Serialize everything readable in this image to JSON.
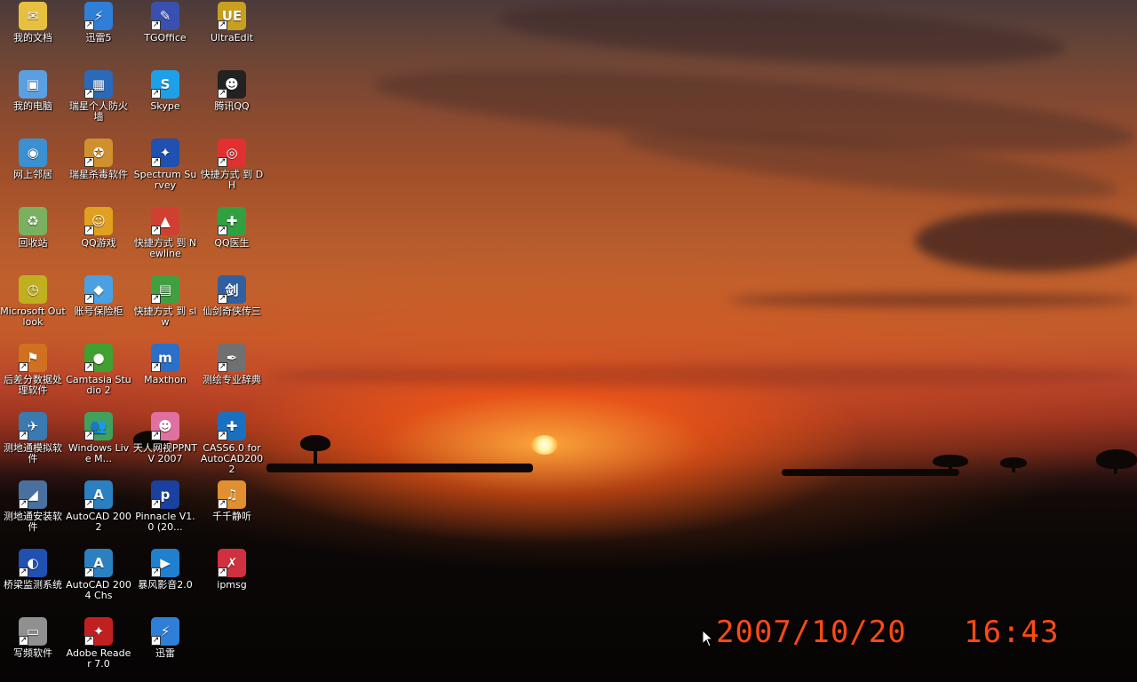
{
  "desktop": {
    "icons": [
      {
        "label": "我的文档",
        "color": "#e8c040",
        "glyph": "✉",
        "shortcut": false
      },
      {
        "label": "迅雷5",
        "color": "#2f7fd8",
        "glyph": "⚡",
        "shortcut": true
      },
      {
        "label": "TGOffice",
        "color": "#3a50b0",
        "glyph": "✎",
        "shortcut": true
      },
      {
        "label": "UltraEdit",
        "color": "#c8a020",
        "glyph": "UE",
        "shortcut": true
      },
      {
        "label": "我的电脑",
        "color": "#5aa0e0",
        "glyph": "▣",
        "shortcut": false
      },
      {
        "label": "瑞星个人防火墙",
        "color": "#2a6ab8",
        "glyph": "▦",
        "shortcut": true
      },
      {
        "label": "Skype",
        "color": "#1ea0e8",
        "glyph": "S",
        "shortcut": true
      },
      {
        "label": "腾讯QQ",
        "color": "#222222",
        "glyph": "☻",
        "shortcut": true
      },
      {
        "label": "网上邻居",
        "color": "#3a90d0",
        "glyph": "◉",
        "shortcut": false
      },
      {
        "label": "瑞星杀毒软件",
        "color": "#d09030",
        "glyph": "✪",
        "shortcut": true
      },
      {
        "label": "Spectrum Survey",
        "color": "#2050b0",
        "glyph": "✦",
        "shortcut": true
      },
      {
        "label": "快捷方式 到 DH",
        "color": "#e03030",
        "glyph": "◎",
        "shortcut": true
      },
      {
        "label": "回收站",
        "color": "#7ab060",
        "glyph": "♻",
        "shortcut": false
      },
      {
        "label": "QQ游戏",
        "color": "#e0a020",
        "glyph": "☺",
        "shortcut": true
      },
      {
        "label": "快捷方式 到 Newline",
        "color": "#d04030",
        "glyph": "▲",
        "shortcut": true
      },
      {
        "label": "QQ医生",
        "color": "#30a040",
        "glyph": "✚",
        "shortcut": true
      },
      {
        "label": "Microsoft Outlook",
        "color": "#c0b020",
        "glyph": "◷",
        "shortcut": false
      },
      {
        "label": "账号保险柜",
        "color": "#4aa0e0",
        "glyph": "◆",
        "shortcut": true
      },
      {
        "label": "快捷方式 到 slw",
        "color": "#40a040",
        "glyph": "▤",
        "shortcut": true
      },
      {
        "label": "仙剑奇侠传三",
        "color": "#3060a0",
        "glyph": "剑",
        "shortcut": true
      },
      {
        "label": "后差分数据处理软件",
        "color": "#d07020",
        "glyph": "⚑",
        "shortcut": true
      },
      {
        "label": "Camtasia Studio 2",
        "color": "#40a030",
        "glyph": "●",
        "shortcut": true
      },
      {
        "label": "Maxthon",
        "color": "#2a70c8",
        "glyph": "m",
        "shortcut": true
      },
      {
        "label": "测绘专业辞典",
        "color": "#707070",
        "glyph": "✒",
        "shortcut": true
      },
      {
        "label": "测地通模拟软件",
        "color": "#3a7ab0",
        "glyph": "✈",
        "shortcut": true
      },
      {
        "label": "Windows Live M...",
        "color": "#40a060",
        "glyph": "👥",
        "shortcut": true
      },
      {
        "label": "天人网视PPNTV 2007",
        "color": "#e070a0",
        "glyph": "☻",
        "shortcut": true
      },
      {
        "label": "CASS6.0 for AutoCAD2002",
        "color": "#1a70c0",
        "glyph": "✚",
        "shortcut": true
      },
      {
        "label": "测地通安装软件",
        "color": "#4a70a0",
        "glyph": "◢",
        "shortcut": true
      },
      {
        "label": "AutoCAD 2002",
        "color": "#2a80c0",
        "glyph": "A",
        "shortcut": true
      },
      {
        "label": "Pinnacle V1.0 (20...",
        "color": "#1a40a0",
        "glyph": "p",
        "shortcut": true
      },
      {
        "label": "千千静听",
        "color": "#e09030",
        "glyph": "♫",
        "shortcut": true
      },
      {
        "label": "桥梁监测系统",
        "color": "#2050b0",
        "glyph": "◐",
        "shortcut": true
      },
      {
        "label": "AutoCAD 2004 Chs",
        "color": "#2a80c0",
        "glyph": "A",
        "shortcut": true
      },
      {
        "label": "暴风影音2.0",
        "color": "#2080d0",
        "glyph": "▶",
        "shortcut": true
      },
      {
        "label": "ipmsg",
        "color": "#d03040",
        "glyph": "✗",
        "shortcut": true
      },
      {
        "label": "写频软件",
        "color": "#909090",
        "glyph": "▭",
        "shortcut": true
      },
      {
        "label": "Adobe Reader 7.0",
        "color": "#c02020",
        "glyph": "✦",
        "shortcut": true
      },
      {
        "label": "迅雷",
        "color": "#2f7fd8",
        "glyph": "⚡",
        "shortcut": true
      }
    ]
  },
  "clock": {
    "date": "2007/10/20",
    "time": "16:43"
  }
}
